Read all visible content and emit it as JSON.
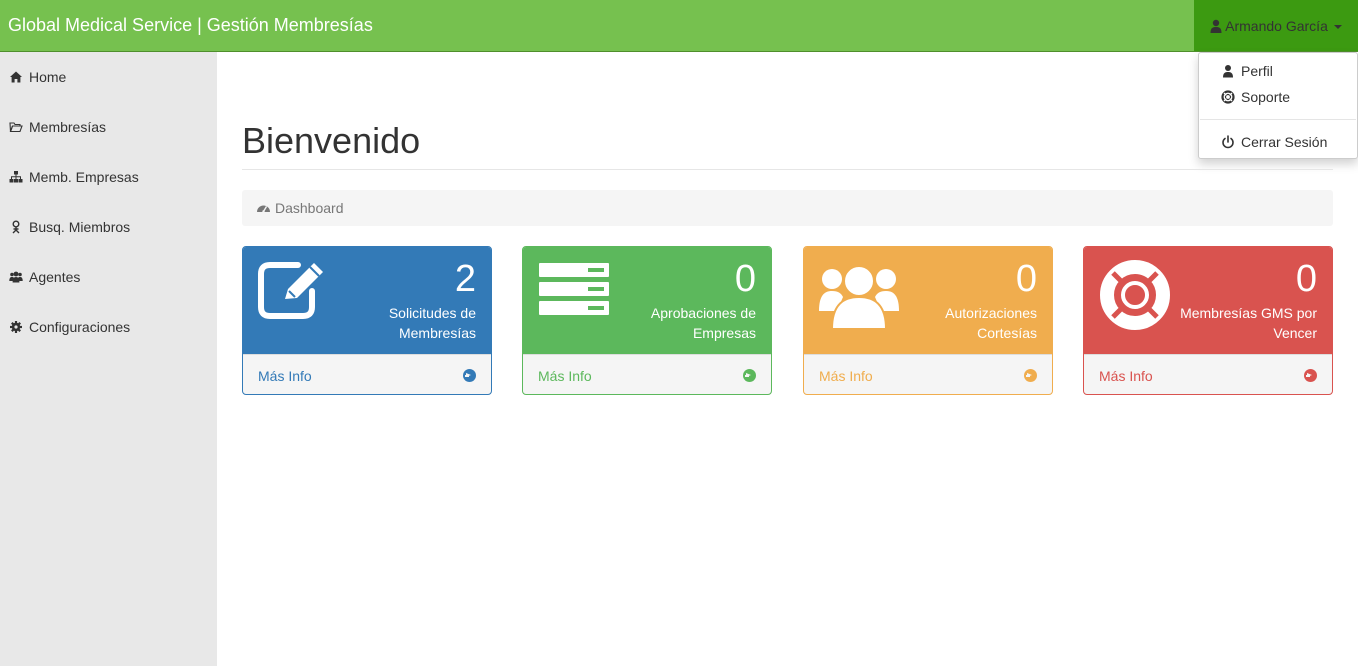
{
  "app": {
    "brand": "Global Medical Service | Gestión Membresías"
  },
  "user_menu": {
    "name": "Armando García",
    "items": [
      {
        "label": "Perfil",
        "icon": "user-icon"
      },
      {
        "label": "Soporte",
        "icon": "life-ring-icon"
      },
      {
        "label": "Cerrar Sesión",
        "icon": "power-icon"
      }
    ]
  },
  "sidebar": {
    "items": [
      {
        "label": "Home",
        "icon": "home-icon"
      },
      {
        "label": "Membresías",
        "icon": "folder-open-icon"
      },
      {
        "label": "Memb. Empresas",
        "icon": "sitemap-icon"
      },
      {
        "label": "Busq. Miembros",
        "icon": "person-icon"
      },
      {
        "label": "Agentes",
        "icon": "users-icon"
      },
      {
        "label": "Configuraciones",
        "icon": "gear-icon"
      }
    ]
  },
  "main": {
    "title": "Bienvenido",
    "breadcrumb": "Dashboard"
  },
  "panels": [
    {
      "count": "2",
      "label": "Solicitudes de Membresías",
      "link": "Más Info",
      "icon": "edit-icon",
      "color": "#337ab7"
    },
    {
      "count": "0",
      "label": "Aprobaciones de Empresas",
      "link": "Más Info",
      "icon": "server-icon",
      "color": "#5cb85c"
    },
    {
      "count": "0",
      "label": "Autorizaciones Cortesías",
      "link": "Más Info",
      "icon": "users-icon",
      "color": "#f0ad4e"
    },
    {
      "count": "0",
      "label": "Membresías GMS por Vencer",
      "link": "Más Info",
      "icon": "life-ring-icon",
      "color": "#d9534f"
    }
  ],
  "colors": {
    "navbar": "#76c14f",
    "user_menu_bg": "#3c9a11",
    "sidebar_bg": "#e8e8e8"
  }
}
